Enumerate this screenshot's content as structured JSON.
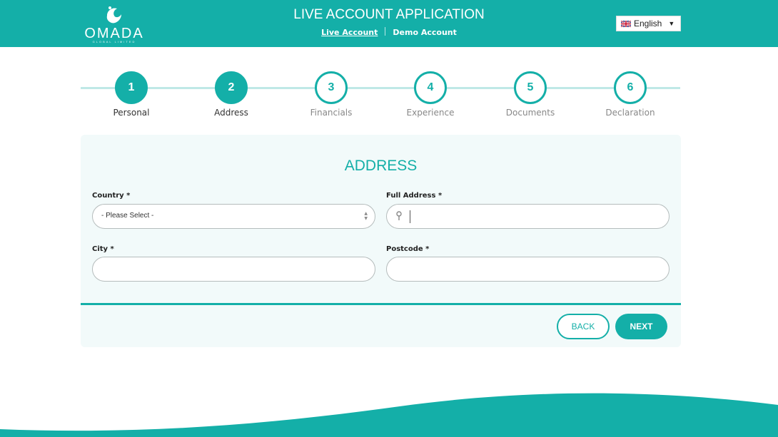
{
  "header": {
    "brand": "OMADA",
    "brand_sub": "GLOBAL LIMITED",
    "title": "LIVE ACCOUNT APPLICATION",
    "links": {
      "live": "Live Account",
      "demo": "Demo Account"
    },
    "language": {
      "selected": "English",
      "flag": "uk-flag-icon"
    }
  },
  "steps": [
    {
      "number": "1",
      "label": "Personal",
      "state": "done"
    },
    {
      "number": "2",
      "label": "Address",
      "state": "done"
    },
    {
      "number": "3",
      "label": "Financials",
      "state": "pending"
    },
    {
      "number": "4",
      "label": "Experience",
      "state": "pending"
    },
    {
      "number": "5",
      "label": "Documents",
      "state": "pending"
    },
    {
      "number": "6",
      "label": "Declaration",
      "state": "pending"
    }
  ],
  "form": {
    "title": "ADDRESS",
    "country": {
      "label": "Country *",
      "value": "- Please Select -"
    },
    "full_address": {
      "label": "Full Address *",
      "value": ""
    },
    "city": {
      "label": "City *",
      "value": ""
    },
    "postcode": {
      "label": "Postcode *",
      "value": ""
    }
  },
  "buttons": {
    "back": "BACK",
    "next": "NEXT"
  },
  "colors": {
    "accent": "#14afa8",
    "card_bg": "#f2fafa",
    "step_line": "#bfe8e6"
  }
}
